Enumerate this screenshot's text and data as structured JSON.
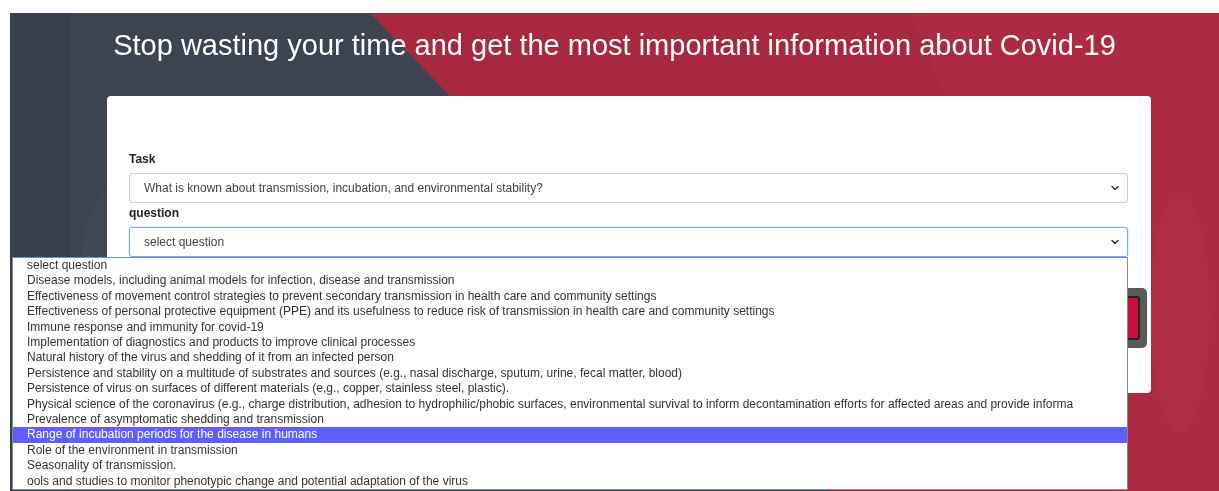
{
  "headline": "Stop wasting your time and get the most important information about Covid-19",
  "form": {
    "fields": [
      {
        "label": "Task",
        "value": "What is known about transmission, incubation, and environmental stability?",
        "focused": false
      },
      {
        "label": "question",
        "value": "select question",
        "focused": true
      }
    ]
  },
  "dropdown": {
    "options": [
      {
        "label": "select question",
        "selected": false
      },
      {
        "label": "Disease models, including animal models for infection, disease and transmission",
        "selected": false
      },
      {
        "label": "Effectiveness of movement control strategies to prevent secondary transmission in health care and community settings",
        "selected": false
      },
      {
        "label": "Effectiveness of personal protective equipment (PPE) and its usefulness to reduce risk of transmission in health care and community settings",
        "selected": false
      },
      {
        "label": "Immune response and immunity for covid-19",
        "selected": false
      },
      {
        "label": "Implementation of diagnostics and products to improve clinical processes",
        "selected": false
      },
      {
        "label": "Natural history of the virus and shedding of it from an infected person",
        "selected": false
      },
      {
        "label": "Persistence and stability on a multitude of substrates and sources (e.g., nasal discharge, sputum, urine, fecal matter, blood)",
        "selected": false
      },
      {
        "label": "Persistence of virus on surfaces of different materials (e,g., copper, stainless steel, plastic).",
        "selected": false
      },
      {
        "label": "Physical science of the coronavirus (e.g., charge distribution, adhesion to hydrophilic/phobic surfaces, environmental survival to inform decontamination efforts for affected areas and provide informa",
        "selected": false
      },
      {
        "label": "Prevalence of asymptomatic shedding and transmission",
        "selected": false
      },
      {
        "label": "Range of incubation periods for the disease in humans",
        "selected": true
      },
      {
        "label": "Role of the environment in transmission",
        "selected": false
      },
      {
        "label": "Seasonality of transmission.",
        "selected": false
      },
      {
        "label": "ools and studies to monitor phenotypic change and potential adaptation of the virus",
        "selected": false
      }
    ]
  }
}
